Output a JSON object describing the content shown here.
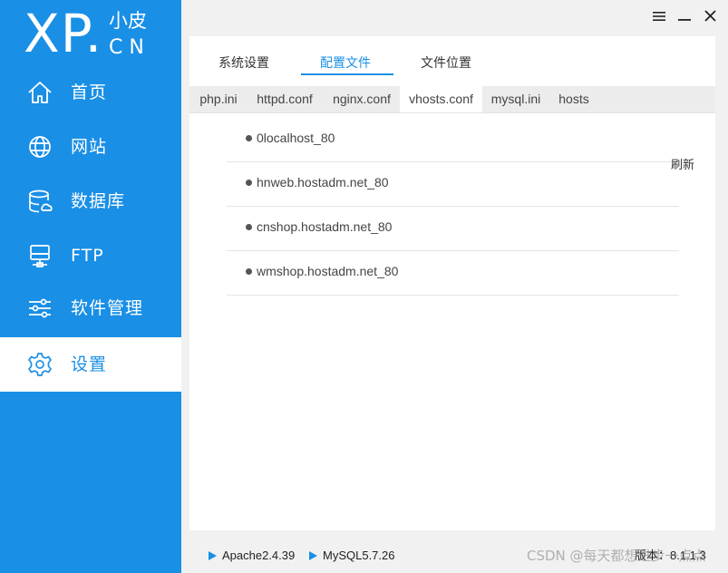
{
  "logo": {
    "xp": "XP.",
    "cn_top": "小皮",
    "cn_bottom": "CN"
  },
  "window_controls": {
    "menu_icon": "menu-icon",
    "minimize_icon": "minimize-icon",
    "close_icon": "close-icon"
  },
  "sidebar": {
    "items": [
      {
        "label": "首页",
        "icon": "home-icon"
      },
      {
        "label": "网站",
        "icon": "globe-icon"
      },
      {
        "label": "数据库",
        "icon": "database-icon"
      },
      {
        "label": "FTP",
        "icon": "ftp-server-icon"
      },
      {
        "label": "软件管理",
        "icon": "sliders-icon"
      },
      {
        "label": "设置",
        "icon": "gear-icon",
        "active": true
      }
    ]
  },
  "top_tabs": [
    {
      "label": "系统设置"
    },
    {
      "label": "配置文件",
      "active": true
    },
    {
      "label": "文件位置"
    }
  ],
  "sub_tabs": [
    {
      "label": "php.ini"
    },
    {
      "label": "httpd.conf"
    },
    {
      "label": "nginx.conf"
    },
    {
      "label": "vhosts.conf",
      "active": true
    },
    {
      "label": "mysql.ini"
    },
    {
      "label": "hosts"
    }
  ],
  "vhosts": [
    "0localhost_80",
    "hnweb.hostadm.net_80",
    "cnshop.hostadm.net_80",
    "wmshop.hostadm.net_80"
  ],
  "refresh_label": "刷新",
  "status_bar": {
    "apache": "Apache2.4.39",
    "mysql": "MySQL5.7.26",
    "version": "版本：8.1.1.3"
  },
  "watermark": "CSDN @每天都想进步一点点",
  "colors": {
    "accent": "#1a8fe6",
    "panel_bg": "#f1f1f1"
  }
}
